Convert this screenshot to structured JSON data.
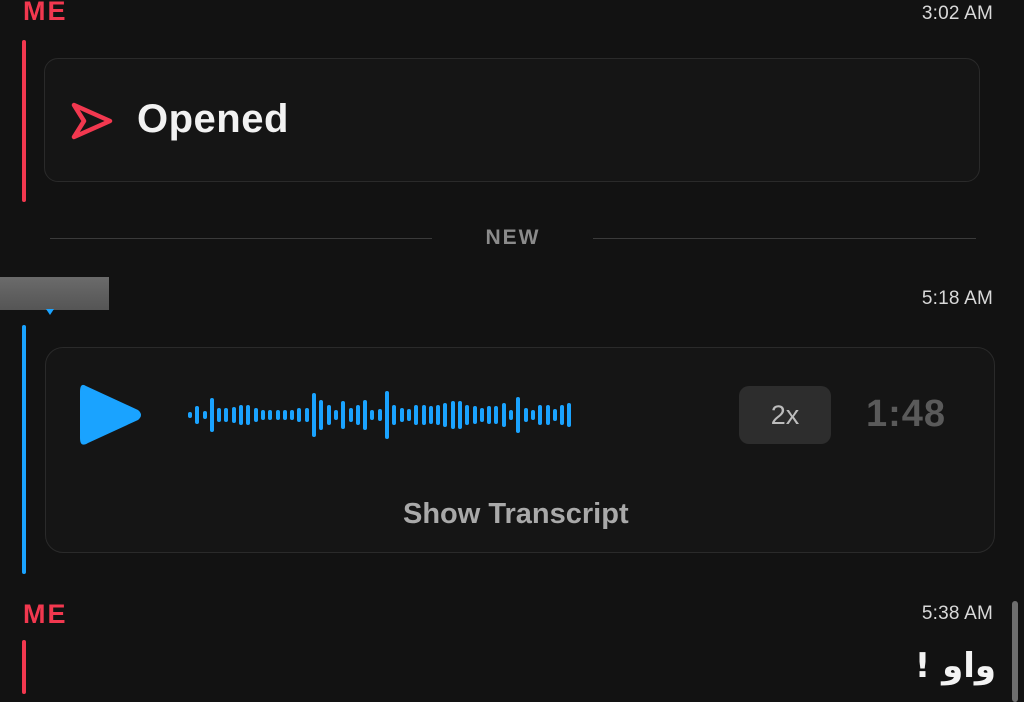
{
  "messages": [
    {
      "sender": "ME",
      "time": "3:02 AM",
      "status": "Opened",
      "status_icon": "sent-arrow-icon"
    },
    {
      "divider": "NEW"
    },
    {
      "time": "5:18 AM",
      "voice": {
        "play_icon": "play-icon",
        "speed": "2x",
        "duration": "1:48",
        "transcript_label": "Show Transcript"
      }
    },
    {
      "sender": "ME",
      "time": "5:38 AM",
      "text": "واو !"
    }
  ],
  "colors": {
    "background": "#121212",
    "me_accent": "#f2384f",
    "other_accent": "#1aa3ff"
  }
}
